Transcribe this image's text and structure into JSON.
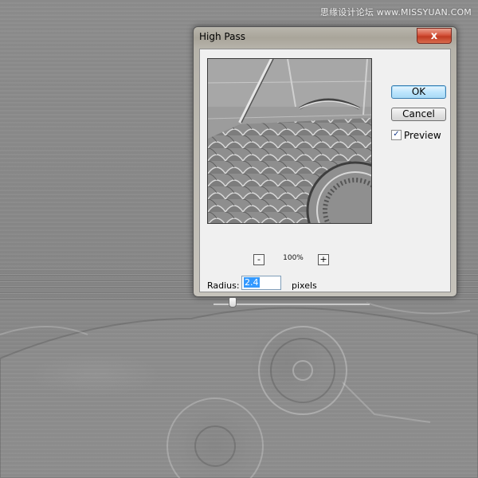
{
  "watermark": {
    "text": "思缘设计论坛 www.MISSYUAN.COM"
  },
  "dialog": {
    "title": "High Pass",
    "close_label": "x",
    "ok_label": "OK",
    "cancel_label": "Cancel",
    "preview": {
      "label": "Preview",
      "checked": true,
      "check_glyph": "✓"
    },
    "zoom": {
      "minus_label": "-",
      "plus_label": "+",
      "level": "100%"
    },
    "radius": {
      "label": "Radius:",
      "value": "2.4",
      "units": "pixels",
      "slider_fraction": 0.12
    }
  },
  "colors": {
    "ok_button": "#bee6fd",
    "close_button": "#c74a32",
    "selection": "#3399ff"
  }
}
